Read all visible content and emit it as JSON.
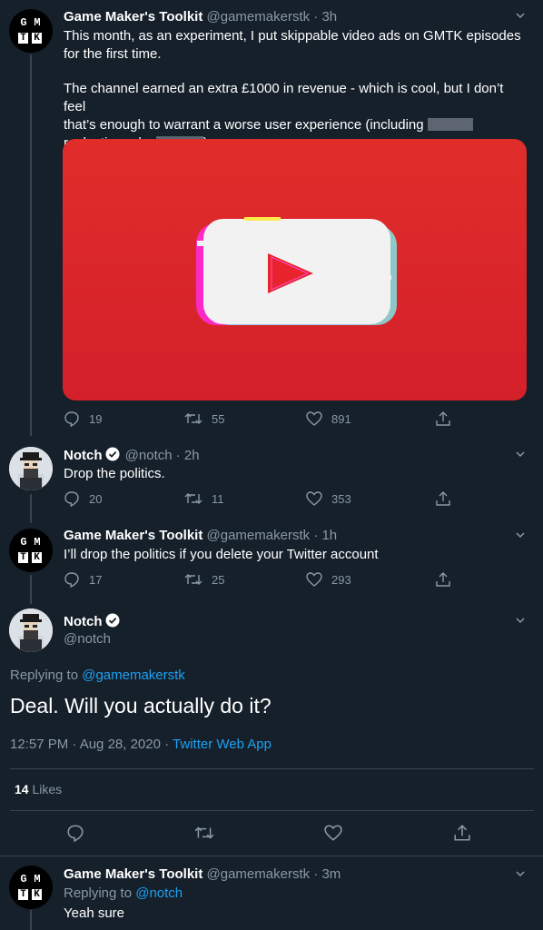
{
  "tweet1": {
    "name": "Game Maker's Toolkit",
    "handle": "@gamemakerstk",
    "time": "· 3h",
    "line1": "This month, as an experiment, I put skippable video ads on GMTK episodes",
    "line2": "for the first time.",
    "line3": "The channel earned an extra £1000 in revenue - which is cool, but I don’t feel",
    "line4": "that’s enough to warrant a worse user experience (including",
    "line5a": "reelection ads,",
    "line5b": ")",
    "replies": "19",
    "retweets": "55",
    "likes": "891"
  },
  "tweet2": {
    "name": "Notch",
    "handle": "@notch",
    "time": "· 2h",
    "text": "Drop the politics.",
    "replies": "20",
    "retweets": "11",
    "likes": "353"
  },
  "tweet3": {
    "name": "Game Maker's Toolkit",
    "handle": "@gamemakerstk",
    "time": "· 1h",
    "text": "I’ll drop the politics if you delete your Twitter account",
    "replies": "17",
    "retweets": "25",
    "likes": "293"
  },
  "main": {
    "name": "Notch",
    "handle": "@notch",
    "replying_prefix": "Replying to",
    "replying_to": "@gamemakerstk",
    "text": "Deal. Will you actually do it?",
    "timestamp": "12:57 PM · Aug 28, 2020 ·",
    "source": "Twitter Web App",
    "likes_count": "14",
    "likes_label": "Likes"
  },
  "tweet4": {
    "name": "Game Maker's Toolkit",
    "handle": "@gamemakerstk",
    "time": "· 3m",
    "replying_prefix": "Replying to",
    "replying_to": "@notch",
    "text": "Yeah sure"
  },
  "avatar_letters": {
    "g": "G",
    "m": "M",
    "t": "T",
    "k": "K"
  },
  "colors": {
    "bg": "#15202b",
    "accent": "#1da1f2",
    "muted": "#8899a6",
    "border": "#38444d",
    "youtube_red": "#e02020"
  }
}
